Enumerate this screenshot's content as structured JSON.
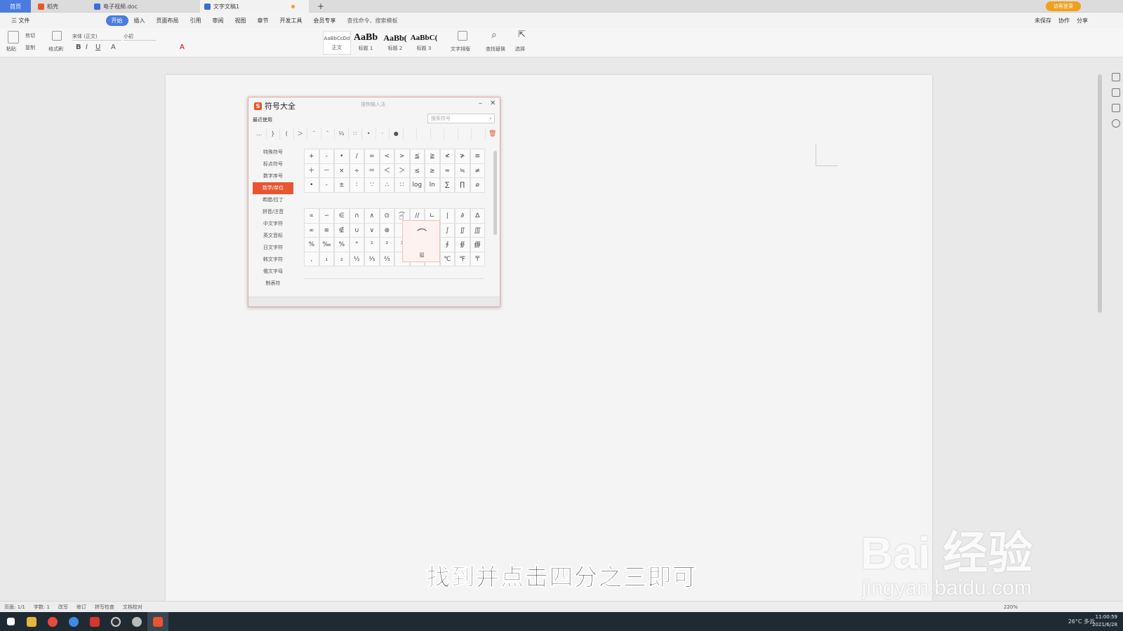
{
  "tabs": {
    "home": "首页",
    "tab1": "稻壳",
    "tab2": "电子视频.doc",
    "tab3": "文字文稿1",
    "add": "+"
  },
  "login": "访客登录",
  "menu": {
    "file": "三 文件",
    "items": [
      "开始",
      "插入",
      "页面布局",
      "引用",
      "审阅",
      "视图",
      "章节",
      "开发工具",
      "会员专享"
    ],
    "search": "查找命令、搜索模板",
    "right": [
      "未保存",
      "协作",
      "分享"
    ]
  },
  "ribbon": {
    "paste": "粘贴",
    "cut": "剪切",
    "copy": "复制",
    "format_painter": "格式刷",
    "font": "宋体 (正文)",
    "size": "小初",
    "styles": [
      {
        "sample": "AaBbCcDd",
        "label": "正文"
      },
      {
        "sample": "AaBb",
        "label": "标题 1"
      },
      {
        "sample": "AaBb(",
        "label": "标题 2"
      },
      {
        "sample": "AaBbC(",
        "label": "标题 3"
      }
    ],
    "text_layout": "文字排版",
    "find_replace": "查找替换",
    "select": "选择"
  },
  "dialog": {
    "title": "符号大全",
    "subtitle": "搜狗输入法",
    "recent_label": "最近使用",
    "search_placeholder": "搜索符号",
    "recent": [
      "…",
      "}",
      "(",
      "＞",
      "¯",
      "ˉ",
      "⅓",
      "∷",
      "•",
      "·",
      "●",
      "",
      "",
      "",
      "",
      "",
      ""
    ],
    "categories": [
      "特殊符号",
      "标点符号",
      "数字序号",
      "数学/单位",
      "希腊/拉丁",
      "拼音/注音",
      "中文字符",
      "英文音标",
      "日文字符",
      "韩文字符",
      "俄文字母",
      "制表符"
    ],
    "active_category": "数学/单位",
    "grid1": [
      "+",
      "-",
      "•",
      "/",
      "=",
      "<",
      ">",
      "≦",
      "≧",
      "≮",
      "≯",
      "≡",
      "＋",
      "－",
      "×",
      "÷",
      "＝",
      "＜",
      "＞",
      "≤",
      "≥",
      "≈",
      "≒",
      "≠",
      "•",
      "-",
      "±",
      "∶",
      "∵",
      "∴",
      "∷",
      "log",
      "ln",
      "∑",
      "∏",
      "⌀"
    ],
    "grid2": [
      "∝",
      "∽",
      "∈",
      "∩",
      "∧",
      "⊙",
      "⌒",
      "//",
      "∟",
      "|",
      "∂",
      "∆",
      "∞",
      "≌",
      "∉",
      "∪",
      "∨",
      "⊕",
      "",
      "",
      "",
      "∫",
      "∬",
      "∭",
      "%",
      "‰",
      "%",
      "°",
      "¹",
      "²",
      "³",
      "",
      "",
      "∮",
      "∯",
      "∰",
      ",",
      "₁",
      "₂",
      "½",
      "⅓",
      "⅔",
      "",
      "",
      "",
      "℃",
      "℉",
      "〒"
    ],
    "preview_symbol": "⌒",
    "preview_name": "弧"
  },
  "status": {
    "page": "页面: 1/1",
    "words": "字数: 1",
    "items": [
      "改写",
      "修订",
      "拼写检查",
      "文档校对"
    ],
    "zoom": "220%"
  },
  "subtitle": "找到并点击四分之三即可",
  "watermark": {
    "brand": "Bai 经验",
    "url": "jingyan.baidu.com"
  },
  "taskbar": {
    "weather": "26°C 多云",
    "time": "11:00:59",
    "date": "2021/6/28"
  }
}
